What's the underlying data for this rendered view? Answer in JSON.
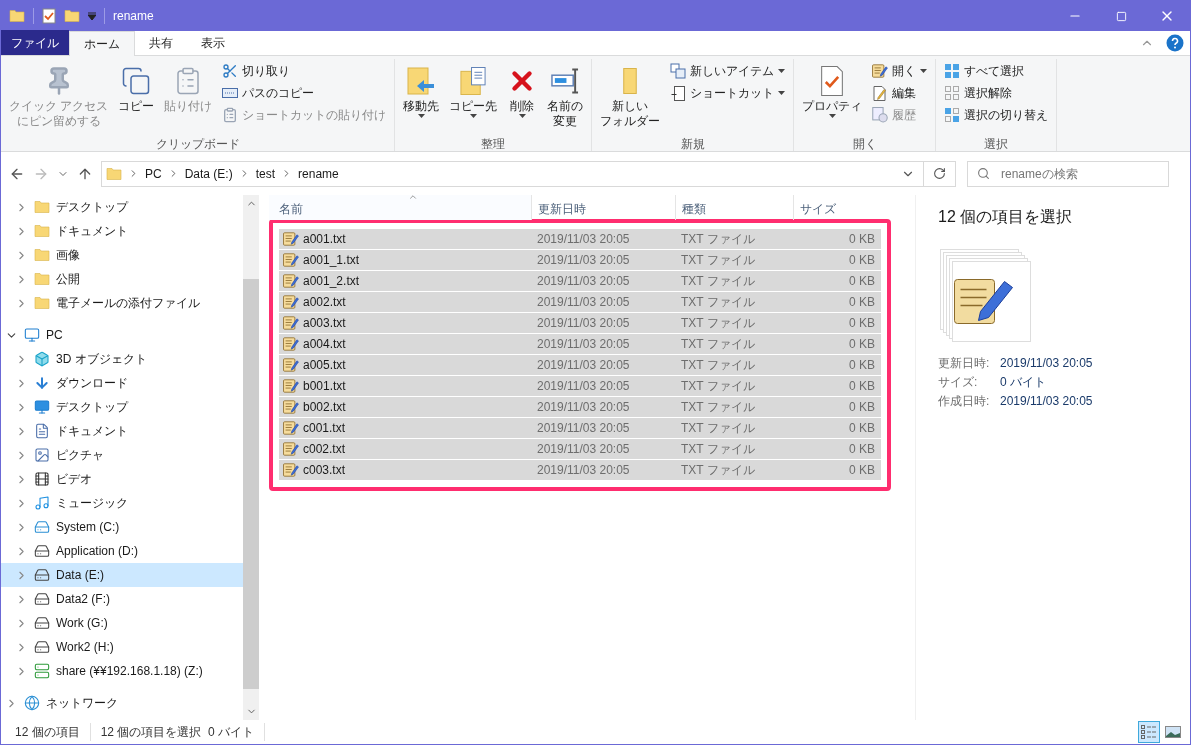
{
  "window": {
    "title": "rename"
  },
  "ribbon": {
    "tabs": [
      {
        "label": "ファイル",
        "kind": "file",
        "selected": false
      },
      {
        "label": "ホーム",
        "kind": "tab",
        "selected": true
      },
      {
        "label": "共有",
        "kind": "tab",
        "selected": false
      },
      {
        "label": "表示",
        "kind": "tab",
        "selected": false
      }
    ],
    "groups": [
      {
        "label": "クリップボード",
        "items": [
          {
            "kind": "large",
            "lines": [
              "クイック アクセス",
              "にピン留めする"
            ],
            "disabled": true,
            "has_menu": false
          },
          {
            "kind": "large",
            "lines": [
              "コピー"
            ],
            "disabled": false,
            "has_menu": false
          },
          {
            "kind": "large",
            "lines": [
              "貼り付け"
            ],
            "disabled": true,
            "has_menu": false
          },
          {
            "kind": "stack",
            "items": [
              {
                "label": "切り取り",
                "disabled": false,
                "has_menu": false
              },
              {
                "label": "パスのコピー",
                "disabled": false,
                "has_menu": false
              },
              {
                "label": "ショートカットの貼り付け",
                "disabled": true,
                "has_menu": false
              }
            ]
          }
        ]
      },
      {
        "label": "整理",
        "items": [
          {
            "kind": "large",
            "lines": [
              "移動先"
            ],
            "disabled": false,
            "has_menu": true
          },
          {
            "kind": "large",
            "lines": [
              "コピー先"
            ],
            "disabled": false,
            "has_menu": true
          },
          {
            "kind": "large",
            "lines": [
              "削除"
            ],
            "disabled": false,
            "has_menu": true
          },
          {
            "kind": "large",
            "lines": [
              "名前の",
              "変更"
            ],
            "disabled": false,
            "has_menu": false
          }
        ]
      },
      {
        "label": "新規",
        "items": [
          {
            "kind": "large",
            "lines": [
              "新しい",
              "フォルダー"
            ],
            "disabled": false,
            "has_menu": false
          },
          {
            "kind": "stack",
            "items": [
              {
                "label": "新しいアイテム",
                "disabled": false,
                "has_menu": true
              },
              {
                "label": "ショートカット",
                "disabled": false,
                "has_menu": true
              }
            ]
          }
        ]
      },
      {
        "label": "開く",
        "items": [
          {
            "kind": "large",
            "lines": [
              "プロパティ"
            ],
            "disabled": false,
            "has_menu": true
          },
          {
            "kind": "stack",
            "items": [
              {
                "label": "開く",
                "disabled": false,
                "has_menu": true
              },
              {
                "label": "編集",
                "disabled": false,
                "has_menu": false
              },
              {
                "label": "履歴",
                "disabled": true,
                "has_menu": false
              }
            ]
          }
        ]
      },
      {
        "label": "選択",
        "items": [
          {
            "kind": "stack",
            "items": [
              {
                "label": "すべて選択",
                "disabled": false,
                "has_menu": false
              },
              {
                "label": "選択解除",
                "disabled": false,
                "has_menu": false
              },
              {
                "label": "選択の切り替え",
                "disabled": false,
                "has_menu": false
              }
            ]
          }
        ]
      }
    ]
  },
  "address": {
    "path": [
      "PC",
      "Data (E:)",
      "test",
      "rename"
    ]
  },
  "search": {
    "placeholder": "renameの検索"
  },
  "navigation": {
    "quick_access_children": [
      {
        "label": "デスクトップ",
        "selected": false
      },
      {
        "label": "ドキュメント",
        "selected": false
      },
      {
        "label": "画像",
        "selected": false
      },
      {
        "label": "公開",
        "selected": false
      },
      {
        "label": "電子メールの添付ファイル",
        "selected": false
      }
    ],
    "tree": [
      {
        "label": "PC",
        "selected": false,
        "expanded": true,
        "children": [
          {
            "label": "3D オブジェクト",
            "selected": false,
            "expanded": false
          },
          {
            "label": "ダウンロード",
            "selected": false,
            "expanded": false
          },
          {
            "label": "デスクトップ",
            "selected": false,
            "expanded": false
          },
          {
            "label": "ドキュメント",
            "selected": false,
            "expanded": false
          },
          {
            "label": "ピクチャ",
            "selected": false,
            "expanded": false
          },
          {
            "label": "ビデオ",
            "selected": false,
            "expanded": false
          },
          {
            "label": "ミュージック",
            "selected": false,
            "expanded": false
          },
          {
            "label": "System (C:)",
            "selected": false,
            "expanded": false
          },
          {
            "label": "Application (D:)",
            "selected": false,
            "expanded": false
          },
          {
            "label": "Data (E:)",
            "selected": true,
            "expanded": false
          },
          {
            "label": "Data2 (F:)",
            "selected": false,
            "expanded": false
          },
          {
            "label": "Work (G:)",
            "selected": false,
            "expanded": false
          },
          {
            "label": "Work2 (H:)",
            "selected": false,
            "expanded": false
          },
          {
            "label": "share (¥¥192.168.1.18) (Z:)",
            "selected": false,
            "expanded": false
          }
        ]
      },
      {
        "label": "ネットワーク",
        "selected": false,
        "expanded": false
      }
    ]
  },
  "file_list": {
    "columns": [
      {
        "label": "名前",
        "sorted": true
      },
      {
        "label": "更新日時",
        "sorted": false
      },
      {
        "label": "種類",
        "sorted": false
      },
      {
        "label": "サイズ",
        "sorted": false
      }
    ],
    "rows": [
      {
        "name": "a001.txt",
        "modified": "2019/11/03 20:05",
        "type": "TXT ファイル",
        "size": "0 KB",
        "selected": true
      },
      {
        "name": "a001_1.txt",
        "modified": "2019/11/03 20:05",
        "type": "TXT ファイル",
        "size": "0 KB",
        "selected": true
      },
      {
        "name": "a001_2.txt",
        "modified": "2019/11/03 20:05",
        "type": "TXT ファイル",
        "size": "0 KB",
        "selected": true
      },
      {
        "name": "a002.txt",
        "modified": "2019/11/03 20:05",
        "type": "TXT ファイル",
        "size": "0 KB",
        "selected": true
      },
      {
        "name": "a003.txt",
        "modified": "2019/11/03 20:05",
        "type": "TXT ファイル",
        "size": "0 KB",
        "selected": true
      },
      {
        "name": "a004.txt",
        "modified": "2019/11/03 20:05",
        "type": "TXT ファイル",
        "size": "0 KB",
        "selected": true
      },
      {
        "name": "a005.txt",
        "modified": "2019/11/03 20:05",
        "type": "TXT ファイル",
        "size": "0 KB",
        "selected": true
      },
      {
        "name": "b001.txt",
        "modified": "2019/11/03 20:05",
        "type": "TXT ファイル",
        "size": "0 KB",
        "selected": true
      },
      {
        "name": "b002.txt",
        "modified": "2019/11/03 20:05",
        "type": "TXT ファイル",
        "size": "0 KB",
        "selected": true
      },
      {
        "name": "c001.txt",
        "modified": "2019/11/03 20:05",
        "type": "TXT ファイル",
        "size": "0 KB",
        "selected": true
      },
      {
        "name": "c002.txt",
        "modified": "2019/11/03 20:05",
        "type": "TXT ファイル",
        "size": "0 KB",
        "selected": true
      },
      {
        "name": "c003.txt",
        "modified": "2019/11/03 20:05",
        "type": "TXT ファイル",
        "size": "0 KB",
        "selected": true
      }
    ]
  },
  "details_pane": {
    "title": "12 個の項目を選択",
    "properties": [
      {
        "label": "更新日時:",
        "value": "2019/11/03 20:05"
      },
      {
        "label": "サイズ:",
        "value": "0 バイト"
      },
      {
        "label": "作成日時:",
        "value": "2019/11/03 20:05"
      }
    ]
  },
  "status_bar": {
    "item_count": "12 個の項目",
    "selection": "12 個の項目を選択  0 バイト",
    "views": [
      {
        "kind": "details",
        "selected": true
      },
      {
        "kind": "large-icons",
        "selected": false
      }
    ]
  }
}
